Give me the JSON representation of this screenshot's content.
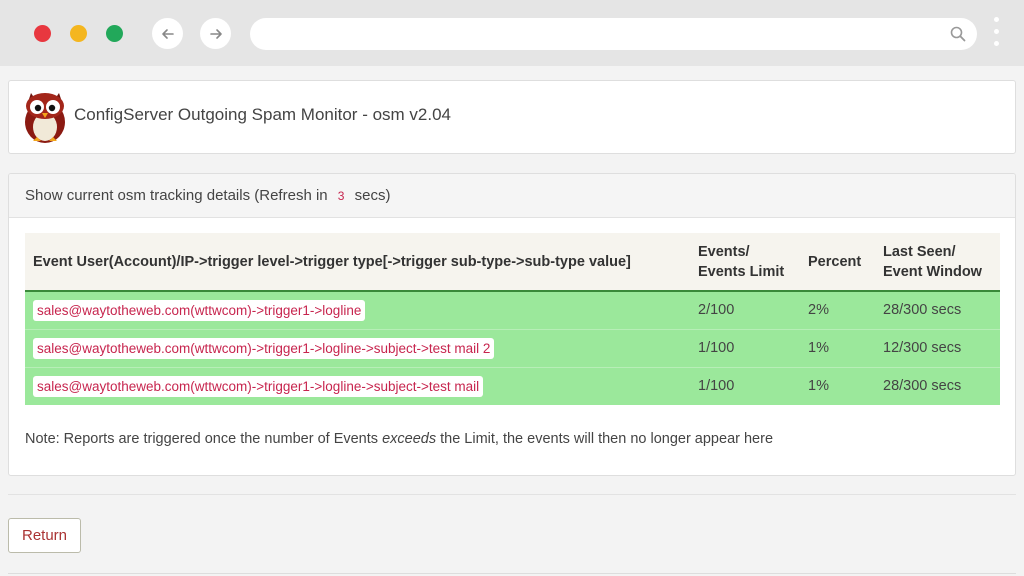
{
  "app": {
    "title": "ConfigServer Outgoing Spam Monitor - osm v2.04"
  },
  "panel": {
    "heading_prefix": "Show current osm tracking details (Refresh in",
    "refresh_seconds": "3",
    "heading_suffix": "secs)"
  },
  "table": {
    "headers": {
      "event": "Event User(Account)/IP->trigger level->trigger type[->trigger sub-type->sub-type value]",
      "events_line1": "Events/",
      "events_line2": "Events Limit",
      "percent": "Percent",
      "last_seen_line1": "Last Seen/",
      "last_seen_line2": "Event Window"
    },
    "rows": [
      {
        "event": "sales@waytotheweb.com(wttwcom)->trigger1->logline",
        "events": "2/100",
        "percent": "2%",
        "last_seen": "28/300 secs"
      },
      {
        "event": "sales@waytotheweb.com(wttwcom)->trigger1->logline->subject->test mail 2",
        "events": "1/100",
        "percent": "1%",
        "last_seen": "12/300 secs"
      },
      {
        "event": "sales@waytotheweb.com(wttwcom)->trigger1->logline->subject->test mail",
        "events": "1/100",
        "percent": "1%",
        "last_seen": "28/300 secs"
      }
    ]
  },
  "note": {
    "prefix": "Note: Reports are triggered once the number of Events",
    "emphasis": "exceeds",
    "suffix": "the Limit, the events will then no longer appear here"
  },
  "buttons": {
    "return_label": "Return"
  },
  "icons": {
    "back": "arrow-left-icon",
    "forward": "arrow-right-icon",
    "search": "search-icon",
    "menu": "kebab-menu-icon",
    "logo": "owl-logo"
  },
  "colors": {
    "row_bg": "#9be89b",
    "code_text": "#c7254e",
    "header_border": "#3a8a3a"
  }
}
